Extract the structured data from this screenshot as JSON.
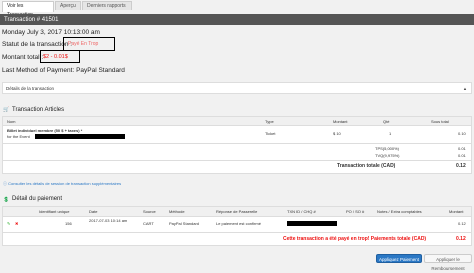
{
  "tabs": [
    "Voir les Transaction",
    "Aperçu",
    "Derniers rapports"
  ],
  "transaction": {
    "number": "Transaction # 41501",
    "date": "Monday July 3, 2017 10:13:00 am",
    "status_label": "Statut de la transaction :",
    "status_value": "Payé En Trop",
    "amount_label": "Montant total :",
    "amount_value": "$2 - 0.01$",
    "payment_method": "Last Method of Payment: PayPal Standard",
    "details_toggle": "Détails de la transaction"
  },
  "articles": {
    "title": "Transaction Articles",
    "headers": [
      "Nom",
      "Type",
      "Montant",
      "Qté",
      "Sous total"
    ],
    "row": {
      "name": "Billet individuel membre (50 $ + taxes) *",
      "for_event": "for the Event",
      "type": "Ticket",
      "amount": "$ 10",
      "qty": "1",
      "subtotal": "0.10"
    },
    "tax1_label": "TPS(5,000%)",
    "tax1_value": "0.01",
    "tax2_label": "TVQ(9,975%)",
    "tax2_value": "0.01",
    "total_label": "Transaction totale (CAD)",
    "total_value": "0.12"
  },
  "extra_link": "Consulter les détails de session de transaction supplémentaires",
  "payment_details": {
    "title": "Détail du paiement",
    "headers": [
      "Identifiant unique",
      "Date",
      "Source",
      "Méthode",
      "Réponse de Passerelle",
      "TXN ID / CHQ #",
      "PO / SO #",
      "Notes / Extra comptables",
      "Montant"
    ],
    "row": {
      "id": "156",
      "date": "2017-07-03 10:14 am",
      "source": "CART",
      "method": "PayPal Standard",
      "response": "Le paiement est confirmé",
      "amount": "0.12"
    },
    "overpaid_label": "Cette transaction a été payé en trop! Paiements totale (CAD)",
    "overpaid_value": "0.12"
  },
  "buttons": {
    "apply_payment": "Appliquez Paiement",
    "apply_refund": "Appliquer le Remboursement"
  }
}
